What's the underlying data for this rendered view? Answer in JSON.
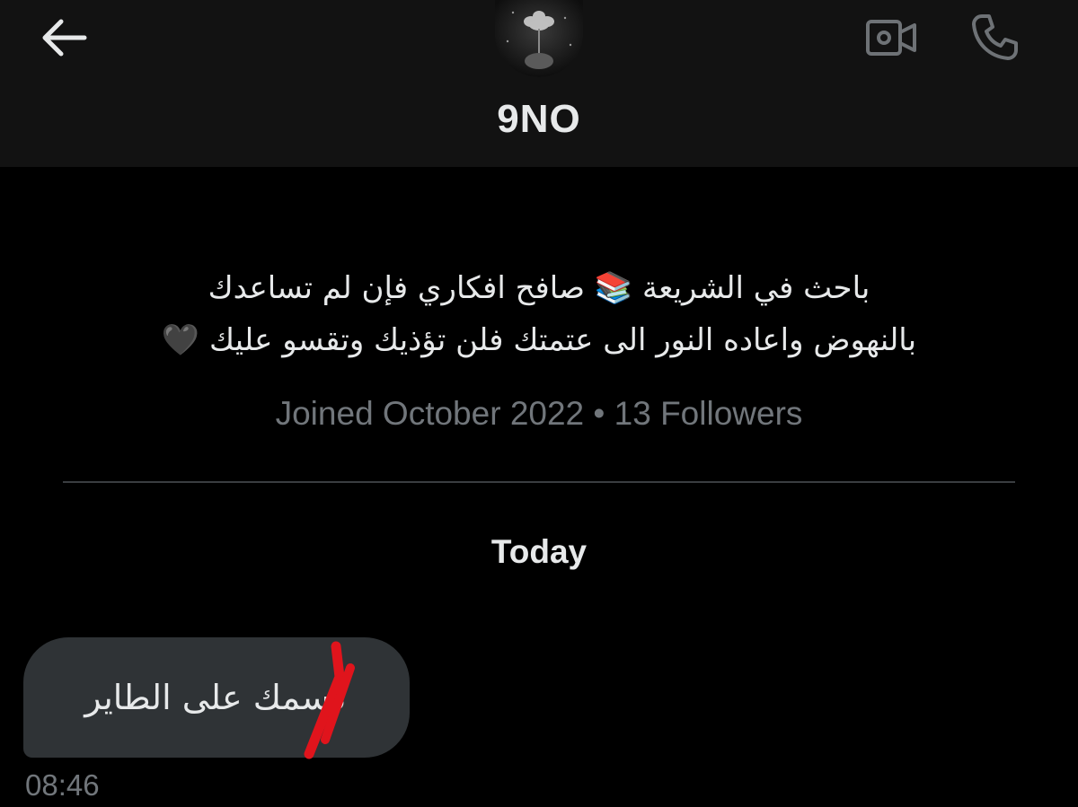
{
  "header": {
    "display_name": "9NO",
    "back_icon": "arrow-left-icon",
    "video_icon": "video-camera-icon",
    "call_icon": "phone-icon"
  },
  "profile": {
    "bio_line_1": "باحث في الشريعة 📚 صافح افكاري فإن لم تساعدك",
    "bio_line_2": "بالنهوض واعاده النور الى عتمتك فلن تؤذيك وتقسو عليك 🖤",
    "meta": "Joined October 2022 • 13 Followers"
  },
  "conversation": {
    "date_separator": "Today",
    "messages": [
      {
        "text": "كسمك على الطاير",
        "time": "08:46"
      }
    ]
  },
  "colors": {
    "background": "#000000",
    "header_background": "#121212",
    "bubble": "#2f3336",
    "secondary_text": "#71767b",
    "redaction_mark": "#e0141c"
  }
}
